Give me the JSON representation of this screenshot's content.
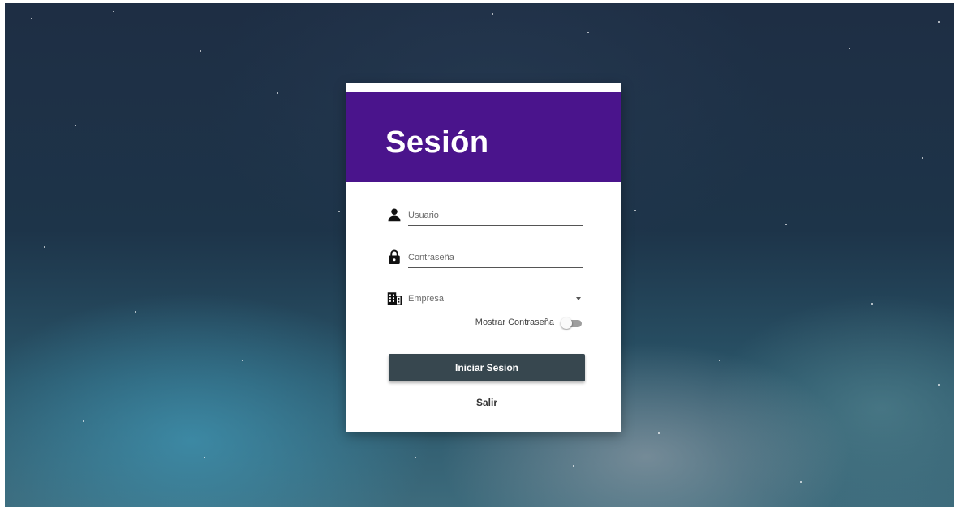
{
  "login": {
    "title": "Sesión",
    "username_placeholder": "Usuario",
    "password_placeholder": "Contraseña",
    "company_placeholder": "Empresa",
    "show_password_label": "Mostrar Contraseña",
    "show_password_on": false,
    "login_button": "Iniciar Sesion",
    "exit_button": "Salir"
  },
  "icons": {
    "username": "person-icon",
    "password": "lock-icon",
    "company": "building-icon",
    "dropdown": "chevron-down-icon"
  },
  "colors": {
    "header": "#4a148c",
    "button": "#37474f",
    "card": "#ffffff"
  }
}
